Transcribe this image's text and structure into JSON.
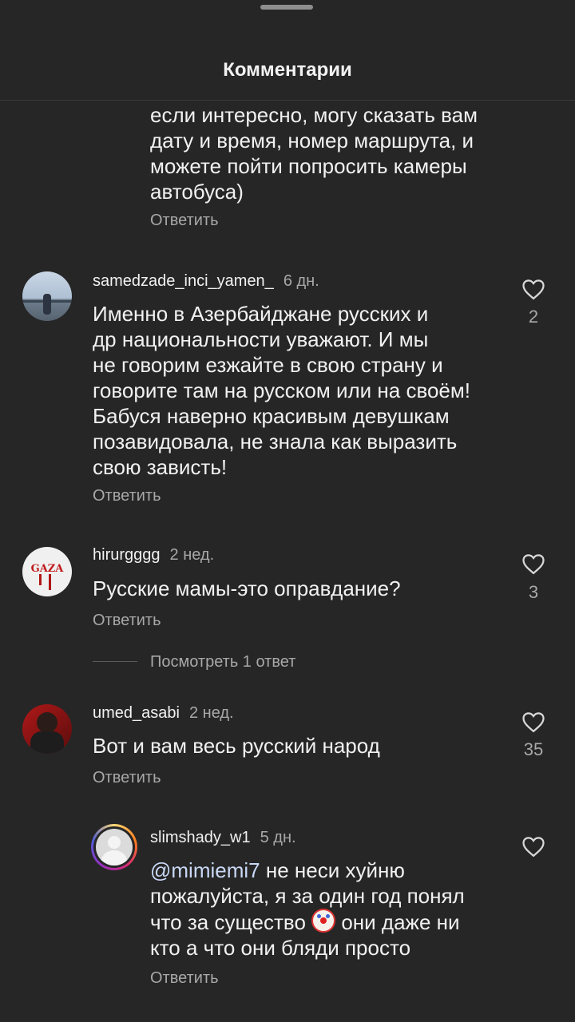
{
  "header": {
    "title": "Комментарии"
  },
  "top_comment": {
    "lines": [
      "если интересно, могу сказать вам",
      "дату и время, номер маршрута, и",
      "можете пойти попросить камеры",
      "автобуса)"
    ],
    "reply_label": "Ответить"
  },
  "comments": [
    {
      "username": "samedzade_inci_yamen_",
      "time": "6 дн.",
      "lines": [
        "Именно в Азербайджане русских и",
        "др национальности уважают. И мы",
        "не говорим езжайте в свою страну и",
        "говорите там на русском или на своём!",
        "Бабуся наверно красивым девушкам",
        "позавидовала, не знала как выразить",
        "свою зависть!"
      ],
      "reply_label": "Ответить",
      "likes": "2"
    },
    {
      "username": "hirurgggg",
      "time": "2 нед.",
      "lines": [
        "Русские мамы-это оправдание?"
      ],
      "reply_label": "Ответить",
      "likes": "3",
      "view_replies": "Посмотреть 1 ответ",
      "avatar_text": "GAZA"
    },
    {
      "username": "umed_asabi",
      "time": "2 нед.",
      "lines": [
        "Вот и вам весь русский народ"
      ],
      "reply_label": "Ответить",
      "likes": "35"
    }
  ],
  "reply": {
    "username": "slimshady_w1",
    "time": "5 дн.",
    "mention": "@mimiemi7",
    "line1_rest": " не неси хуйню",
    "line2": "пожалуйста, я за один год понял",
    "line3_before": "что за существо ",
    "line3_after": " они даже ни",
    "line4": "кто а что они бляди просто",
    "reply_label": "Ответить"
  },
  "icons": {
    "heart": "heart-outline-icon",
    "emoji": "clown-face-emoji"
  },
  "colors": {
    "background": "#262626",
    "secondary_text": "#a8a8a8",
    "mention": "#c9d8f5"
  }
}
